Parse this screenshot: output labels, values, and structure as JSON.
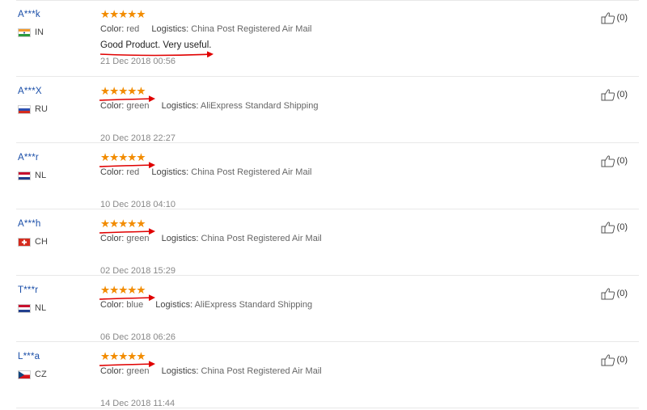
{
  "reviews": [
    {
      "name": "A***k",
      "country": "IN",
      "flag": "india",
      "stars": "★★★★★",
      "color_label": "Color:",
      "color": "red",
      "logistics_label": "Logistics:",
      "logistics": "China Post Registered Air Mail",
      "feedback": "Good Product. Very useful.",
      "date": "21 Dec 2018 00:56",
      "helpful": "(0)"
    },
    {
      "name": "A***X",
      "country": "RU",
      "flag": "russia",
      "stars": "★★★★★",
      "color_label": "Color:",
      "color": "green",
      "logistics_label": "Logistics:",
      "logistics": "AliExpress Standard Shipping",
      "date": "20 Dec 2018 22:27",
      "helpful": "(0)"
    },
    {
      "name": "A***r",
      "country": "NL",
      "flag": "netherlands",
      "stars": "★★★★★",
      "color_label": "Color:",
      "color": "red",
      "logistics_label": "Logistics:",
      "logistics": "China Post Registered Air Mail",
      "date": "10 Dec 2018 04:10",
      "helpful": "(0)"
    },
    {
      "name": "A***h",
      "country": "CH",
      "flag": "switzerland",
      "stars": "★★★★★",
      "color_label": "Color:",
      "color": "green",
      "logistics_label": "Logistics:",
      "logistics": "China Post Registered Air Mail",
      "date": "02 Dec 2018 15:29",
      "helpful": "(0)"
    },
    {
      "name": "T***r",
      "country": "NL",
      "flag": "netherlands",
      "stars": "★★★★★",
      "color_label": "Color:",
      "color": "blue",
      "logistics_label": "Logistics:",
      "logistics": "AliExpress Standard Shipping",
      "date": "06 Dec 2018 06:26",
      "helpful": "(0)"
    },
    {
      "name": "L***a",
      "country": "CZ",
      "flag": "czech",
      "stars": "★★★★★",
      "color_label": "Color:",
      "color": "green",
      "logistics_label": "Logistics:",
      "logistics": "China Post Registered Air Mail",
      "date": "14 Dec 2018 11:44",
      "helpful": "(0)"
    }
  ],
  "colors": {
    "star": "#f28c00",
    "name": "#1a4ea8",
    "arrow": "#e00000"
  },
  "icons": {
    "helpful": "thumbs-up-icon"
  }
}
